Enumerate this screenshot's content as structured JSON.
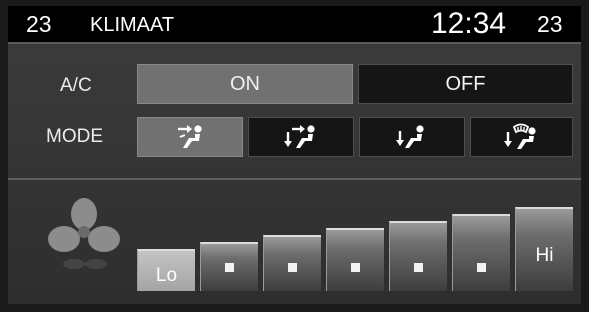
{
  "header": {
    "temp_left": "23",
    "title": "KLIMAAT",
    "clock": "12:34",
    "temp_right": "23"
  },
  "ac": {
    "label": "A/C",
    "on_label": "ON",
    "off_label": "OFF",
    "selected": "ON"
  },
  "mode": {
    "label": "MODE",
    "options": [
      {
        "icon": "face-vent-icon",
        "selected": true
      },
      {
        "icon": "face-floor-vent-icon",
        "selected": false
      },
      {
        "icon": "floor-vent-icon",
        "selected": false
      },
      {
        "icon": "floor-defrost-vent-icon",
        "selected": false
      }
    ]
  },
  "fan": {
    "icon": "fan-icon",
    "low_label": "Lo",
    "high_label": "Hi",
    "levels": 7,
    "current_level": 1
  },
  "colors": {
    "selected_button": "#717171",
    "unselected_button": "#151515",
    "header_background": "#000000"
  }
}
